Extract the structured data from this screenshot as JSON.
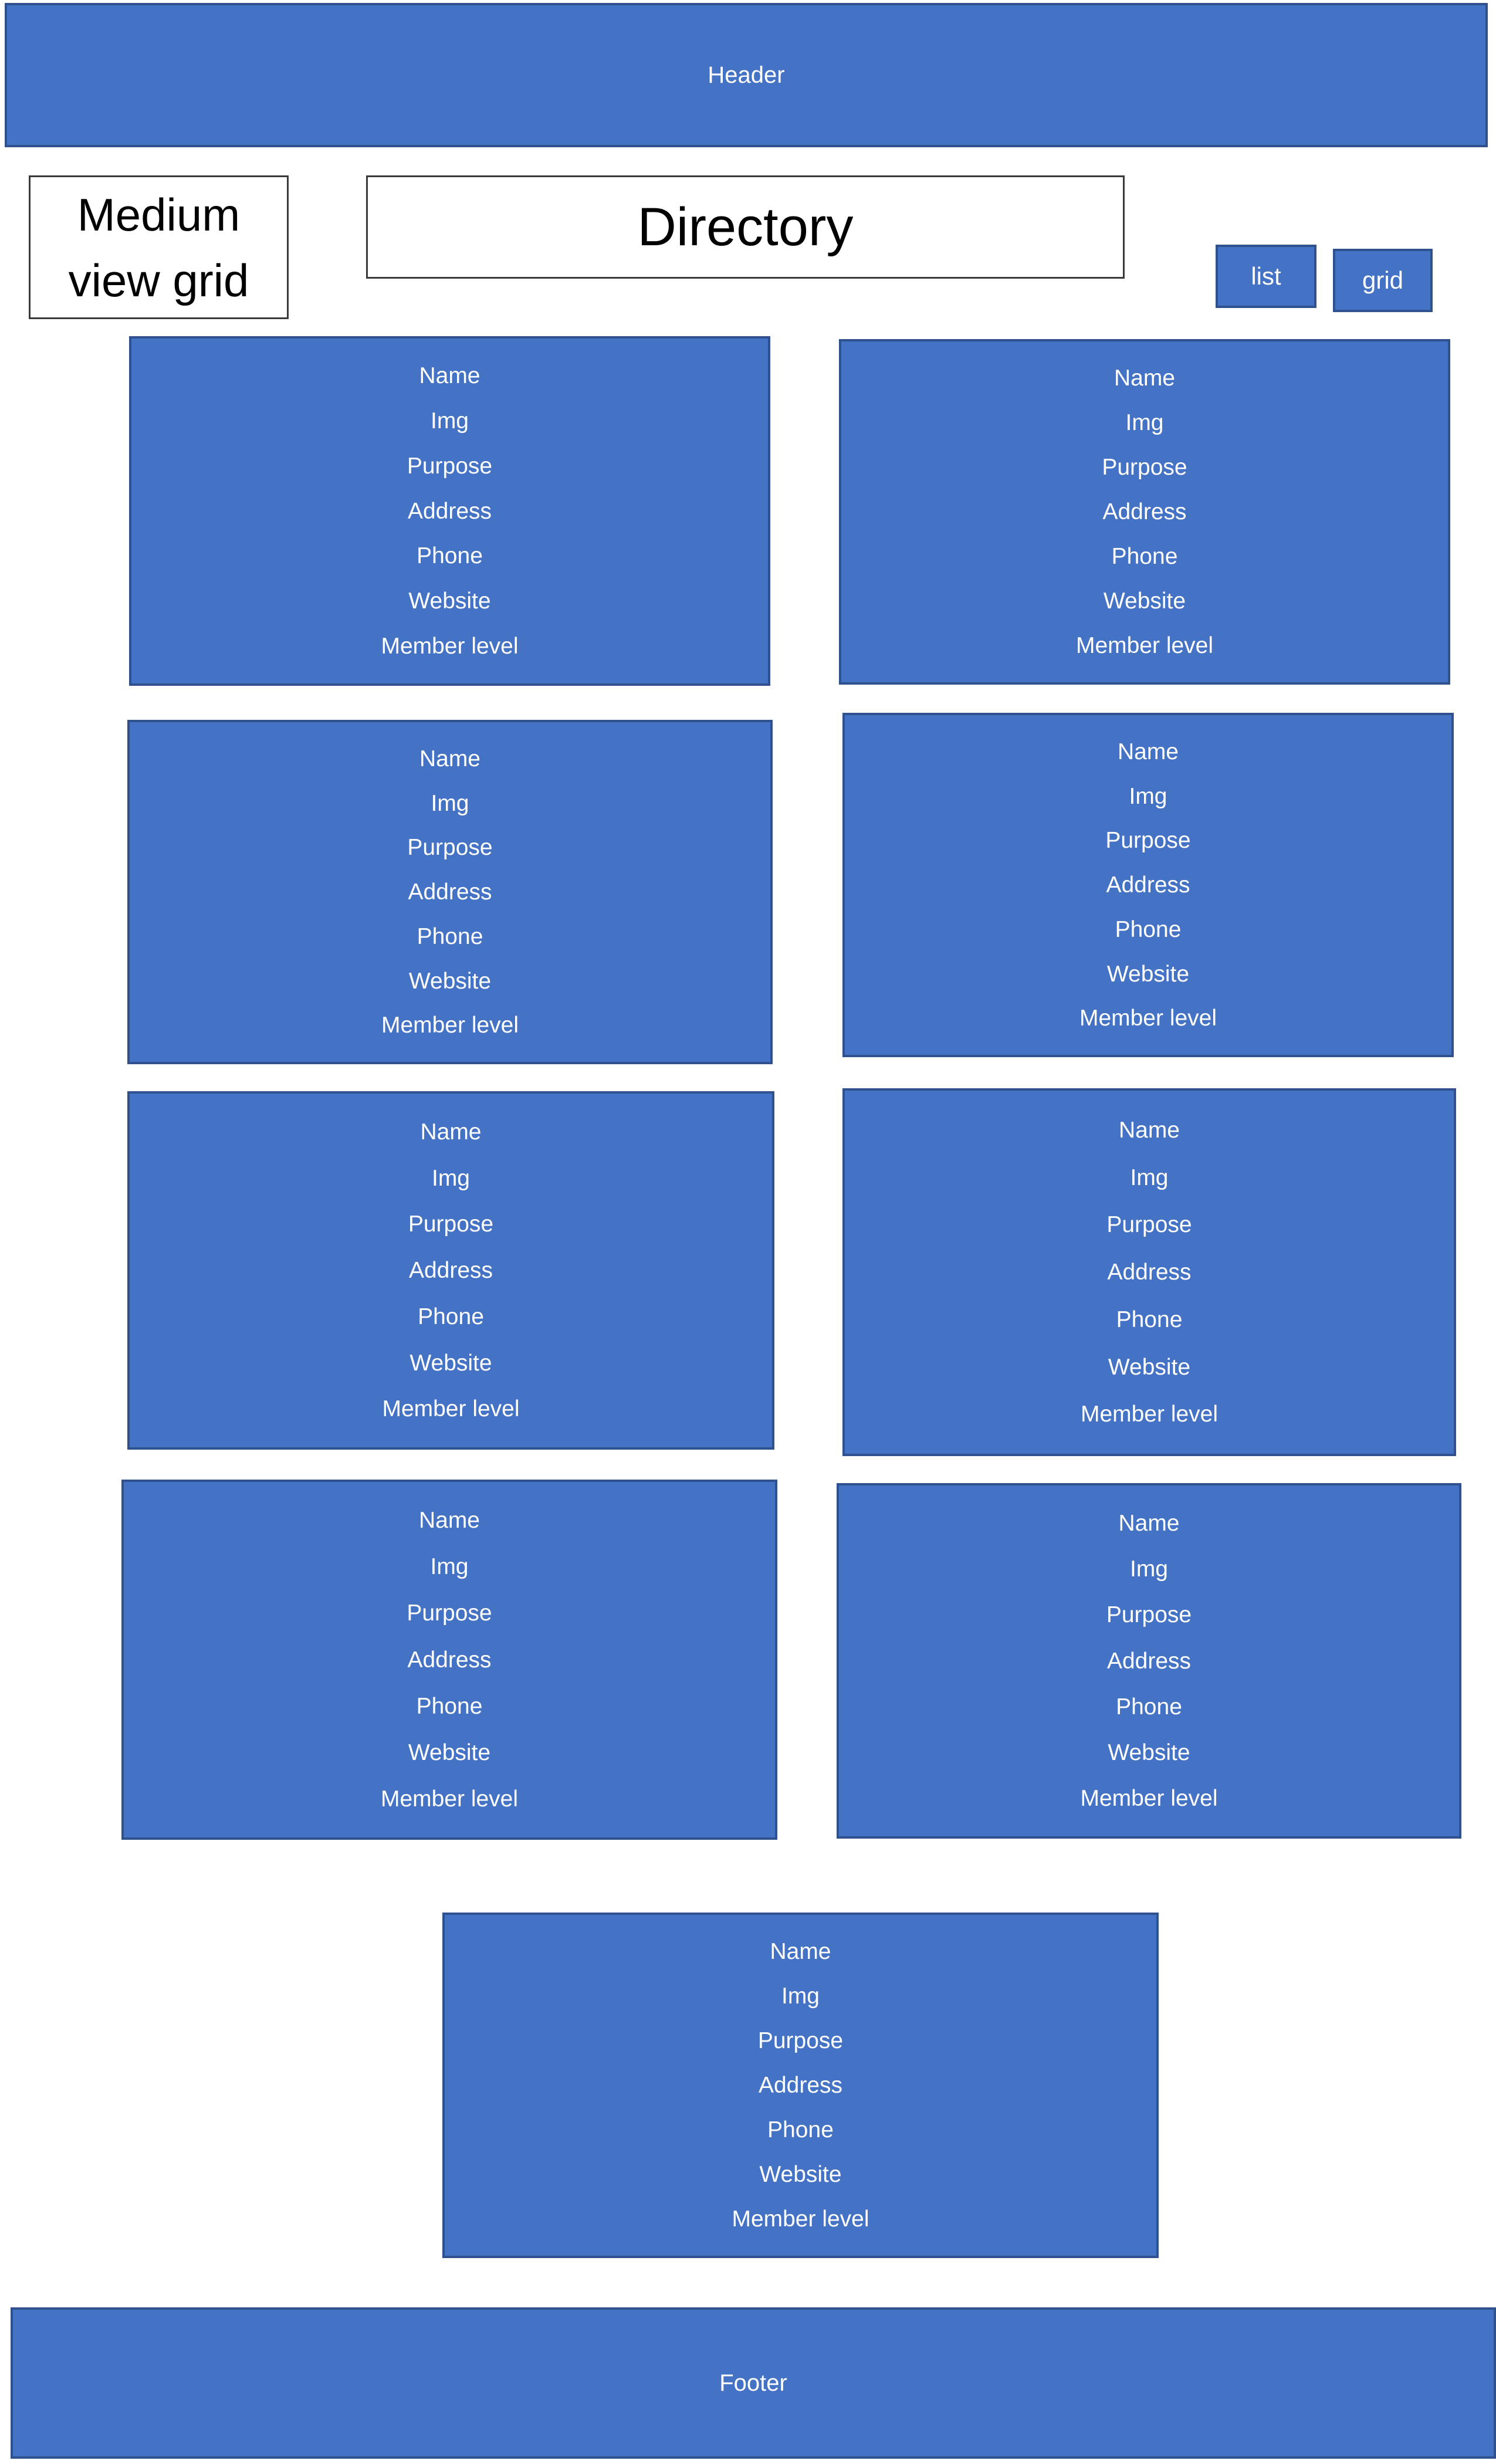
{
  "header": {
    "label": "Header"
  },
  "view_label": {
    "text": "Medium view grid"
  },
  "page_title": {
    "text": "Directory"
  },
  "view_toggle": {
    "list_label": "list",
    "grid_label": "grid"
  },
  "card_fields": [
    "Name",
    "Img",
    "Purpose",
    "Address",
    "Phone",
    "Website",
    "Member level"
  ],
  "card_count": 9,
  "footer": {
    "label": "Footer"
  },
  "colors": {
    "card_fill": "#4472c4",
    "card_border": "#2f528f",
    "text_on_blue": "#ffffff"
  }
}
